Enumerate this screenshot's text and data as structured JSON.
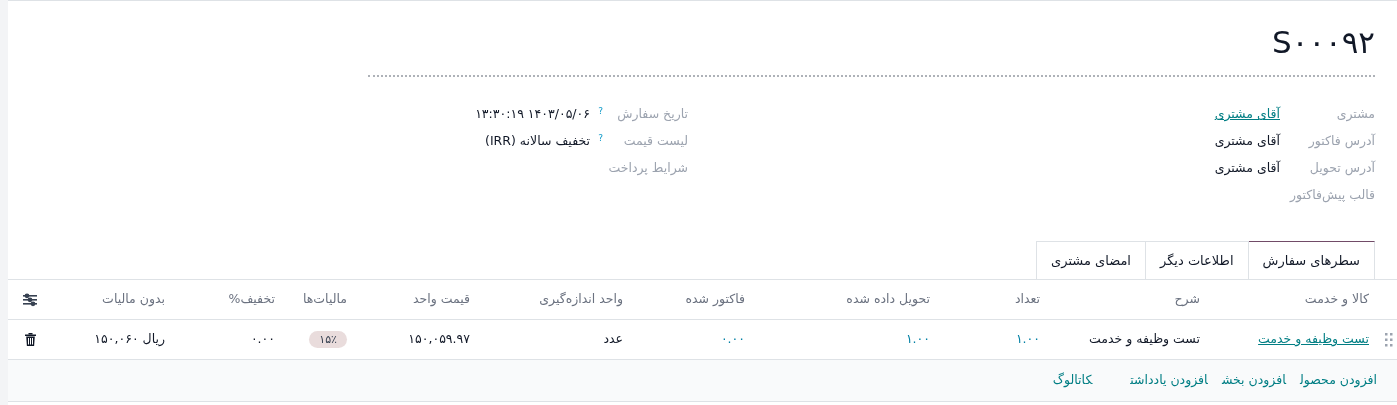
{
  "title": "S۰۰۰۹۲",
  "fields_right": [
    {
      "label": "مشتری",
      "value": "آقای مشتری",
      "kind": "link"
    },
    {
      "label": "آدرس فاکتور",
      "value": "آقای مشتری",
      "kind": "text"
    },
    {
      "label": "آدرس تحویل",
      "value": "آقای مشتری",
      "kind": "text"
    },
    {
      "label": "قالب پیش‌فاکتور",
      "kind": "empty"
    }
  ],
  "fields_left": [
    {
      "label": "تاریخ سفارش",
      "help": "?",
      "value": "۱۴۰۳/۰۵/۰۶ ۱۳:۳۰:۱۹"
    },
    {
      "label": "لیست قیمت",
      "help": "?",
      "value": "تخفیف سالانه (IRR)"
    },
    {
      "label": "شرایط پرداخت"
    }
  ],
  "tabs": [
    {
      "label": "سطرهای سفارش",
      "selected": true
    },
    {
      "label": "اطلاعات دیگر",
      "selected": false
    },
    {
      "label": "امضای مشتری",
      "selected": false
    }
  ],
  "table": {
    "columns": [
      "کالا و خدمت",
      "شرح",
      "تعداد",
      "تحویل داده شده",
      "فاکتور شده",
      "واحد اندازه‌گیری",
      "قیمت واحد",
      "مالیات‌ها",
      "تخفیف%",
      "بدون مالیات"
    ],
    "rows": [
      {
        "cells": [
          {
            "text": "تست وظیفه و خدمت",
            "kind": "link"
          },
          {
            "text": "تست وظیفه و خدمت",
            "kind": "text"
          },
          {
            "text": "۱.۰۰",
            "kind": "number"
          },
          {
            "text": "۱.۰۰",
            "kind": "number"
          },
          {
            "text": "۰.۰۰",
            "kind": "number"
          },
          {
            "text": "عدد",
            "kind": "text"
          },
          {
            "text": "۱۵۰,۰۵۹.۹۷",
            "kind": "text"
          },
          {
            "text": "۱۵٪",
            "kind": "badge"
          },
          {
            "text": "۰.۰۰",
            "kind": "text"
          },
          {
            "text": "ریال ۱۵۰,۰۶۰",
            "kind": "text"
          }
        ]
      }
    ],
    "add_links": [
      "افزودن محصول",
      "افزودن بخش",
      "افزودن یادداشت",
      "کاتالوگ"
    ]
  }
}
